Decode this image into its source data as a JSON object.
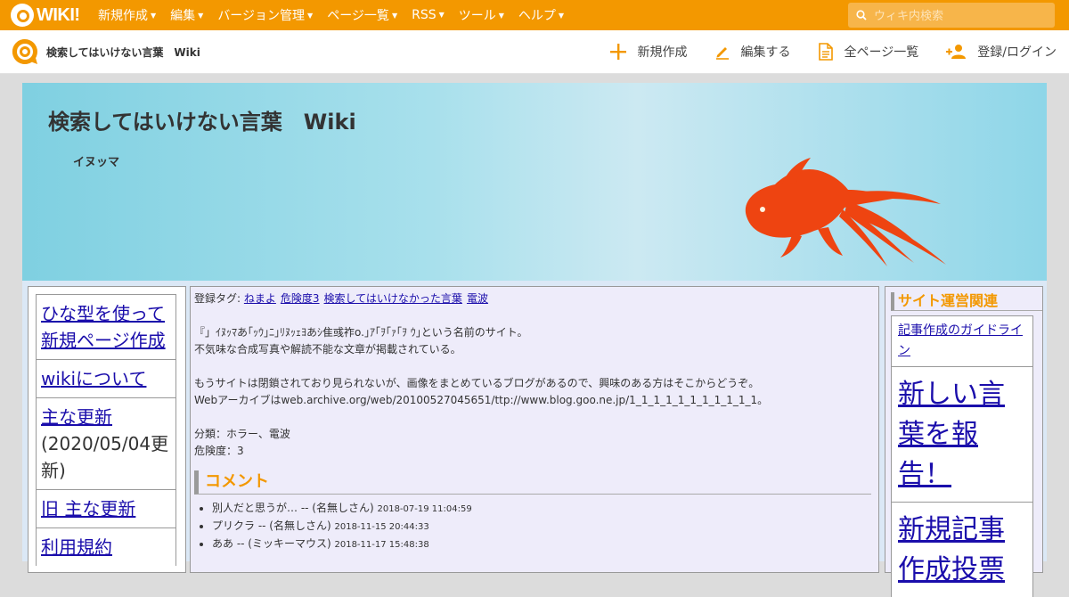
{
  "topbar": {
    "logo_text": "WIKI!",
    "menu": [
      "新規作成",
      "編集",
      "バージョン管理",
      "ページ一覧",
      "RSS",
      "ツール",
      "ヘルプ"
    ],
    "search_placeholder": "ウィキ内検索"
  },
  "subbar": {
    "site_name": "検索してはいけない言葉　Wiki",
    "actions": [
      {
        "label": "新規作成",
        "icon": "plus-icon"
      },
      {
        "label": "編集する",
        "icon": "pencil-icon"
      },
      {
        "label": "全ページ一覧",
        "icon": "document-icon"
      },
      {
        "label": "登録/ログイン",
        "icon": "add-user-icon"
      }
    ]
  },
  "banner": {
    "title": "検索してはいけない言葉　Wiki",
    "subtitle": "イヌッマ"
  },
  "leftnav": {
    "items": [
      {
        "label": "ひな型を使って新規ページ作成",
        "note": ""
      },
      {
        "label": "wikiについて",
        "note": ""
      },
      {
        "label": "主な更新",
        "note": "(2020/05/04更新)"
      },
      {
        "label": "旧 主な更新",
        "note": ""
      },
      {
        "label": "利用規約",
        "note": ""
      }
    ]
  },
  "main": {
    "tags_label": "登録タグ:",
    "tags": [
      "ねまよ",
      "危険度3",
      "検索してはいけなかった言葉",
      "電波"
    ],
    "lines": [
      "『」ｲﾇｯﾏあ｢ｯｳ｣ﾆ｣ﾘﾇｯｪﾖあｼ隹彧祚o.｣ｱ｢ｦ｢ｧ｢ｦ ｳ｣という名前のサイト。",
      "不気味な合成写真や解読不能な文章が掲載されている。",
      "",
      "もうサイトは閉鎖されており見られないが、画像をまとめているブログがあるので、興味のある方はそこからどうぞ。",
      "Webアーカイブはweb.archive.org/web/20100527045651/ttp://www.blog.goo.ne.jp/1_1_1_1_1_1_1_1_1_1_1。",
      "",
      "分類：ホラー、電波",
      "危険度：3"
    ],
    "comment_heading": "コメント",
    "comments": [
      {
        "text": "別人だと思うが… -- (名無しさん)",
        "time": "2018-07-19 11:04:59"
      },
      {
        "text": "プリクラ -- (名無しさん)",
        "time": "2018-11-15 20:44:33"
      },
      {
        "text": "ああ -- (ミッキーマウス)",
        "time": "2018-11-17 15:48:38"
      }
    ]
  },
  "right": {
    "heading": "サイト運営関連",
    "items": [
      {
        "label": "記事作成のガイドライン",
        "size": "small"
      },
      {
        "label": "新しい言葉を報告！",
        "size": "big"
      },
      {
        "label": "新規記事作成投票",
        "size": "big"
      }
    ]
  },
  "colors": {
    "accent": "#f39800",
    "link": "#1a0dab",
    "fish": "#ee4411"
  }
}
